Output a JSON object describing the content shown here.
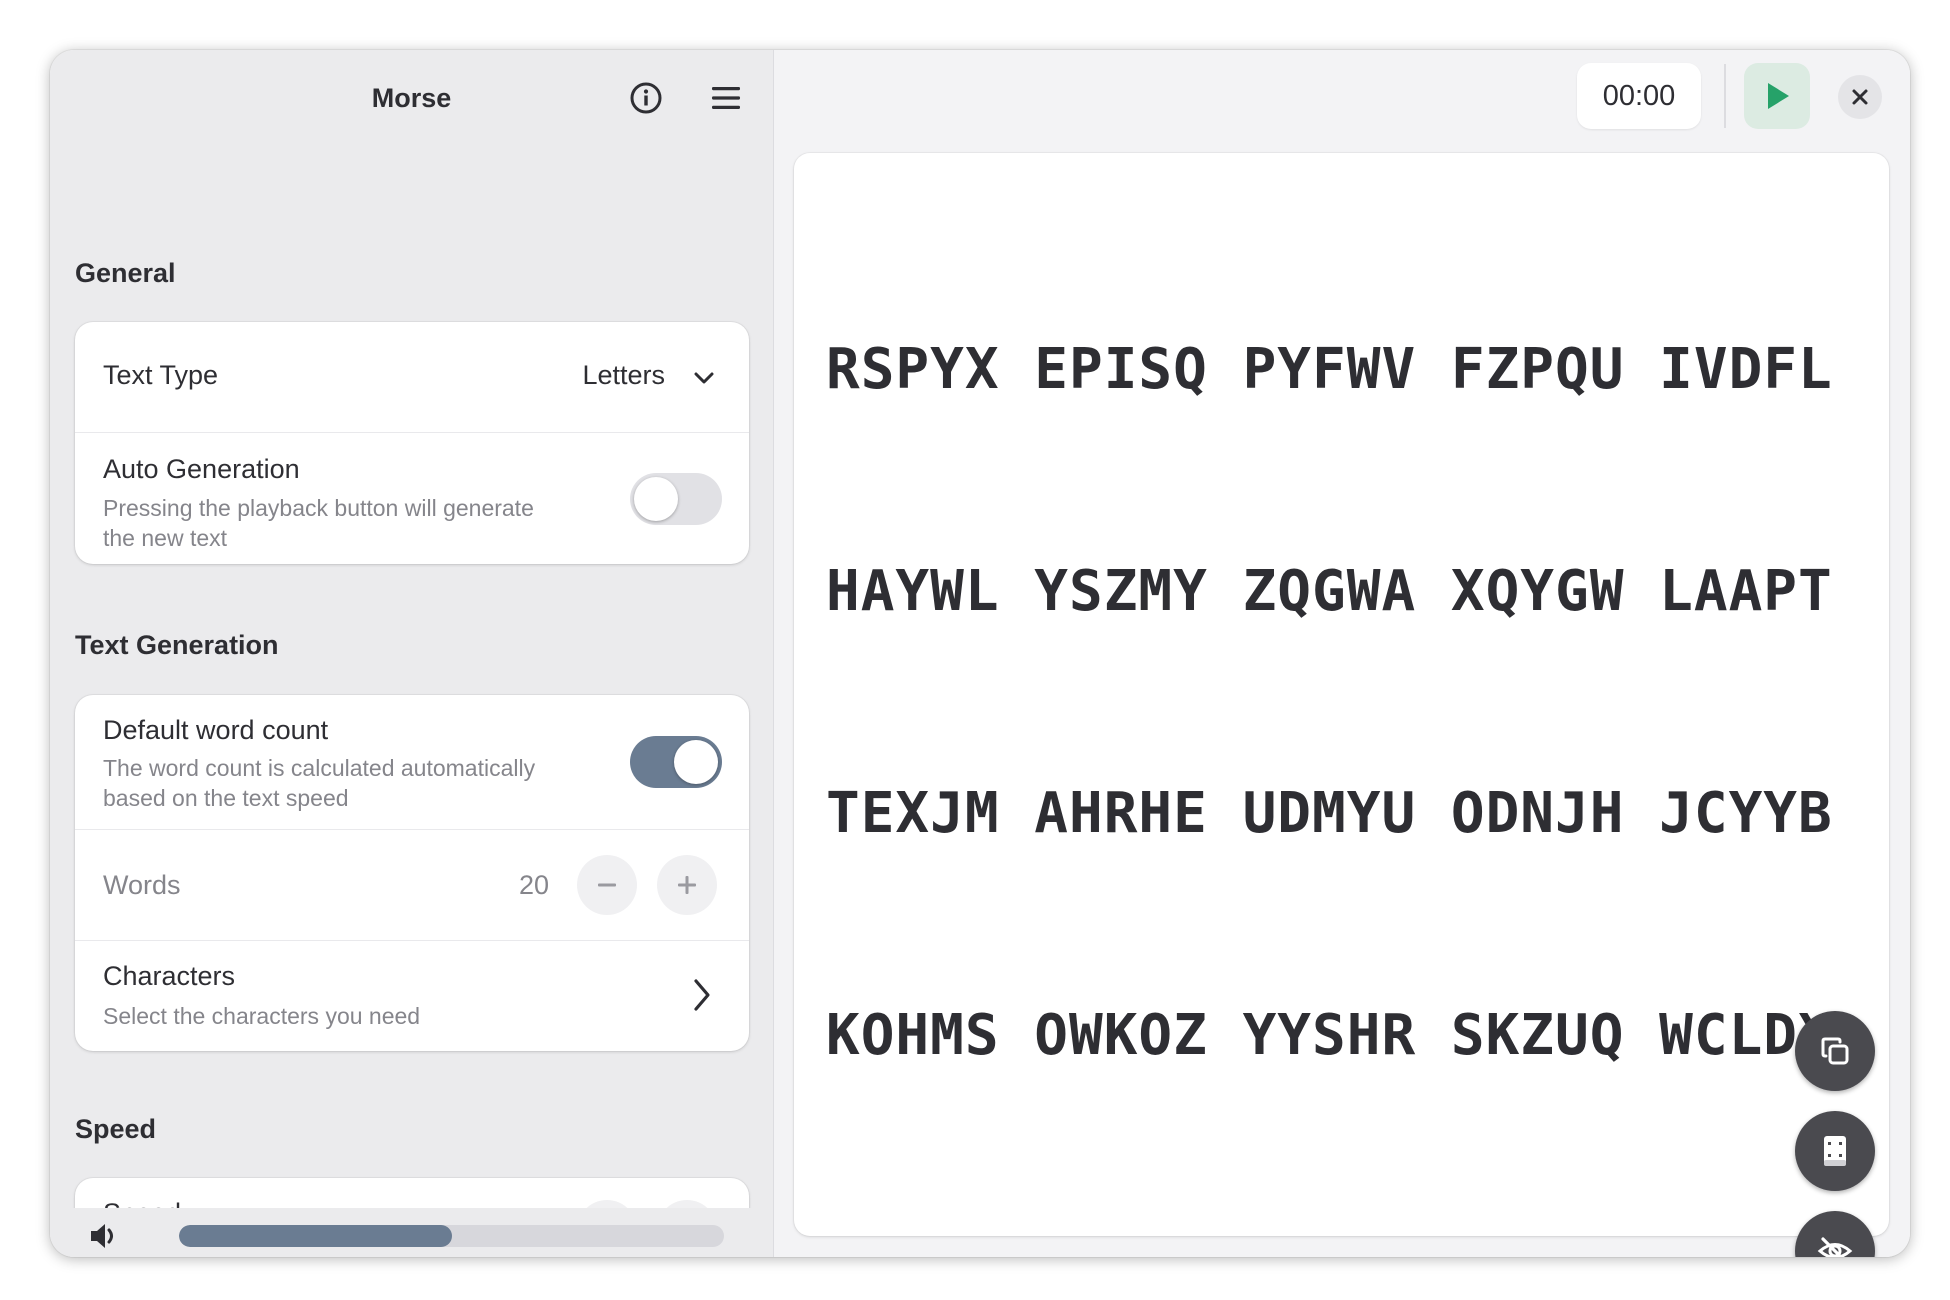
{
  "sidebar": {
    "title": "Morse",
    "general": {
      "heading": "General",
      "text_type_label": "Text Type",
      "text_type_value": "Letters",
      "auto_generation_title": "Auto Generation",
      "auto_generation_subtitle_line1": "Pressing the playback button will generate",
      "auto_generation_subtitle_line2": "the new text",
      "auto_generation_enabled": false
    },
    "text_generation": {
      "heading": "Text Generation",
      "default_word_count_title": "Default word count",
      "default_word_count_subtitle_line1": "The word count is calculated automatically",
      "default_word_count_subtitle_line2": "based on the text speed",
      "default_word_count_enabled": true,
      "words_label": "Words",
      "words_value": "20",
      "characters_title": "Characters",
      "characters_subtitle": "Select the characters you need"
    },
    "speed": {
      "heading": "Speed",
      "partial_row_label": "Speed"
    },
    "volume": {
      "level_fraction": 0.5
    }
  },
  "main": {
    "timer": "00:00",
    "text_lines": [
      "RSPYX EPISQ PYFWV FZPQU IVDFL",
      "HAYWL YSZMY ZQGWA XQYGW LAAPT",
      "TEXJM AHRHE UDMYU ODNJH JCYYB",
      "KOHMS OWKOZ YYSHR SKZUQ WCLDX"
    ],
    "fab_icons": [
      "copy-icon",
      "flashcard-icon",
      "eye-off-icon"
    ]
  },
  "colors": {
    "accent": "#6a7c92",
    "play_green": "#26a269",
    "fab_bg": "#4a4a4f"
  }
}
